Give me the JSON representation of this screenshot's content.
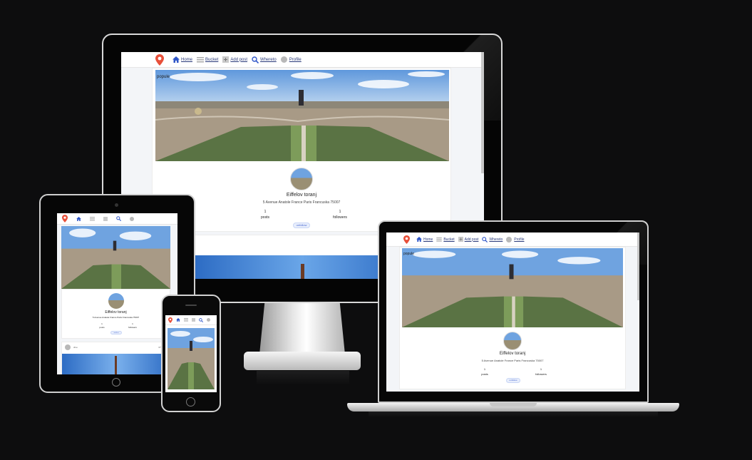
{
  "nav": {
    "home": "Home",
    "bucket": "Bucket",
    "add_post": "Add post",
    "whereto": "Whereto",
    "profile": "Profile"
  },
  "profile": {
    "cover_label": "popule",
    "name": "Eiffelov toranj",
    "address": "5 Avenue Anatole France Paris Francuska 75007",
    "posts_count": "1",
    "posts_label": "posts",
    "followers_count": "1",
    "followers_label": "followers",
    "unfollow_label": "unfollow"
  },
  "post": {
    "author": "drvo",
    "date": "07 Jul 2021"
  },
  "colors": {
    "background": "#0d0d0e",
    "nav_link": "#2a3a7a",
    "home_icon": "#2f56c8",
    "pin_icon": "#e8503a",
    "sky": "#6fa3e0",
    "button_fill": "#e8eefc"
  },
  "icons": {
    "logo": "map-pin-logo-icon",
    "home": "home-icon",
    "bucket": "bucket-list-icon",
    "add_post": "add-image-icon",
    "whereto": "search-location-icon",
    "profile": "user-avatar-icon"
  }
}
